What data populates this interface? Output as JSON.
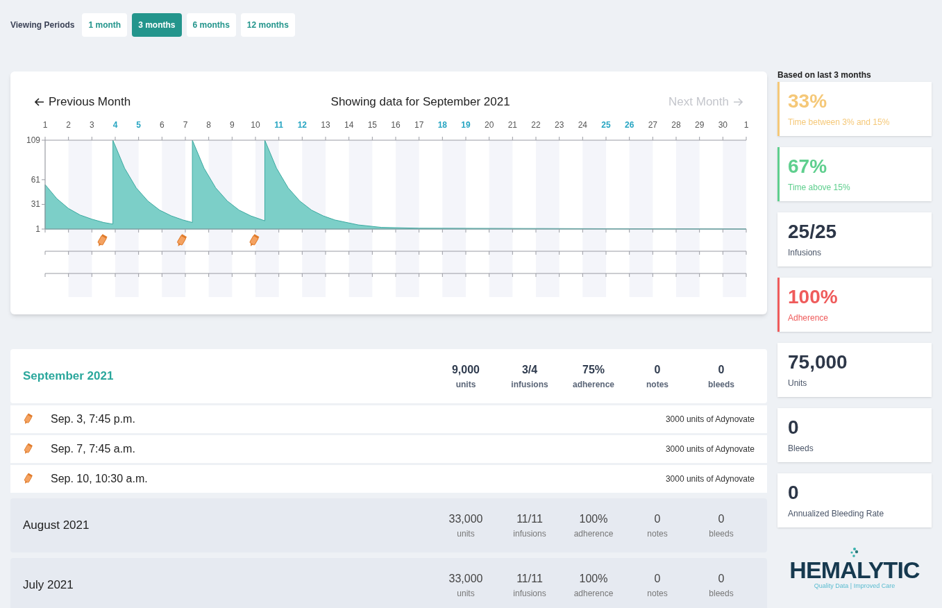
{
  "viewing_periods": {
    "label": "Viewing Periods",
    "options": [
      {
        "label": "1 month",
        "selected": false
      },
      {
        "label": "3 months",
        "selected": true
      },
      {
        "label": "6 months",
        "selected": false
      },
      {
        "label": "12 months",
        "selected": false
      }
    ]
  },
  "chart_card": {
    "previous": {
      "label": "Previous Month",
      "disabled": false
    },
    "title": "Showing data for September 2021",
    "next": {
      "label": "Next Month",
      "disabled": true
    },
    "day_labels": [
      {
        "label": "1",
        "weekend": false
      },
      {
        "label": "2",
        "weekend": false
      },
      {
        "label": "3",
        "weekend": false
      },
      {
        "label": "4",
        "weekend": true
      },
      {
        "label": "5",
        "weekend": true
      },
      {
        "label": "6",
        "weekend": false
      },
      {
        "label": "7",
        "weekend": false
      },
      {
        "label": "8",
        "weekend": false
      },
      {
        "label": "9",
        "weekend": false
      },
      {
        "label": "10",
        "weekend": false
      },
      {
        "label": "11",
        "weekend": true
      },
      {
        "label": "12",
        "weekend": true
      },
      {
        "label": "13",
        "weekend": false
      },
      {
        "label": "14",
        "weekend": false
      },
      {
        "label": "15",
        "weekend": false
      },
      {
        "label": "16",
        "weekend": false
      },
      {
        "label": "17",
        "weekend": false
      },
      {
        "label": "18",
        "weekend": true
      },
      {
        "label": "19",
        "weekend": true
      },
      {
        "label": "20",
        "weekend": false
      },
      {
        "label": "21",
        "weekend": false
      },
      {
        "label": "22",
        "weekend": false
      },
      {
        "label": "23",
        "weekend": false
      },
      {
        "label": "24",
        "weekend": false
      },
      {
        "label": "25",
        "weekend": true
      },
      {
        "label": "26",
        "weekend": true
      },
      {
        "label": "27",
        "weekend": false
      },
      {
        "label": "28",
        "weekend": false
      },
      {
        "label": "29",
        "weekend": false
      },
      {
        "label": "30",
        "weekend": false
      },
      {
        "label": "1",
        "weekend": false
      }
    ],
    "chart_data": {
      "type": "area",
      "xlim": [
        1,
        31
      ],
      "ylim": [
        1,
        109
      ],
      "yticks": [
        1,
        31,
        61,
        109
      ],
      "xticks": [
        1,
        2,
        3,
        4,
        5,
        6,
        7,
        8,
        9,
        10,
        11,
        12,
        13,
        14,
        15,
        16,
        17,
        18,
        19,
        20,
        21,
        22,
        23,
        24,
        25,
        26,
        27,
        28,
        29,
        30
      ],
      "x": [
        1,
        1.5,
        2,
        2.5,
        3,
        3.5,
        3.9,
        3.9,
        4.4,
        4.9,
        5.4,
        5.9,
        6.4,
        6.9,
        7.3,
        7.3,
        7.8,
        8.3,
        8.8,
        9.3,
        9.8,
        10.3,
        10.4,
        10.4,
        10.9,
        11.4,
        11.9,
        12.4,
        12.9,
        13.4,
        14.4,
        15.4,
        17,
        31
      ],
      "series": [
        {
          "color": "#7ccfc8",
          "values": [
            55,
            38,
            26,
            18,
            13,
            9,
            7,
            109,
            75,
            51,
            35,
            24,
            17,
            12,
            9,
            109,
            75,
            51,
            35,
            24,
            17,
            12,
            11,
            109,
            75,
            51,
            35,
            24,
            17,
            12,
            6,
            3,
            2,
            1
          ]
        }
      ]
    }
  },
  "months": [
    {
      "title": "September 2021",
      "expanded": true,
      "stats": [
        {
          "value": "9,000",
          "label": "units"
        },
        {
          "value": "3/4",
          "label": "infusions"
        },
        {
          "value": "75%",
          "label": "adherence"
        },
        {
          "value": "0",
          "label": "notes"
        },
        {
          "value": "0",
          "label": "bleeds"
        }
      ],
      "entries": [
        {
          "time": "Sep. 3, 7:45 p.m.",
          "detail": "3000 units of Adynovate"
        },
        {
          "time": "Sep. 7, 7:45 a.m.",
          "detail": "3000 units of Adynovate"
        },
        {
          "time": "Sep. 10, 10:30 a.m.",
          "detail": "3000 units of Adynovate"
        }
      ]
    },
    {
      "title": "August 2021",
      "expanded": false,
      "stats": [
        {
          "value": "33,000",
          "label": "units"
        },
        {
          "value": "11/11",
          "label": "infusions"
        },
        {
          "value": "100%",
          "label": "adherence"
        },
        {
          "value": "0",
          "label": "notes"
        },
        {
          "value": "0",
          "label": "bleeds"
        }
      ]
    },
    {
      "title": "July 2021",
      "expanded": false,
      "stats": [
        {
          "value": "33,000",
          "label": "units"
        },
        {
          "value": "11/11",
          "label": "infusions"
        },
        {
          "value": "100%",
          "label": "adherence"
        },
        {
          "value": "0",
          "label": "notes"
        },
        {
          "value": "0",
          "label": "bleeds"
        }
      ]
    }
  ],
  "summary": {
    "title": "Based on last 3 months",
    "cards": [
      {
        "value": "33%",
        "label": "Time between 3% and 15%",
        "color": "#f5c878"
      },
      {
        "value": "67%",
        "label": "Time above 15%",
        "color": "#5fcf8e"
      },
      {
        "value": "25/25",
        "label": "Infusions"
      },
      {
        "value": "100%",
        "label": "Adherence",
        "color": "#ef5b5b"
      },
      {
        "value": "75,000",
        "label": "Units"
      },
      {
        "value": "0",
        "label": "Bleeds"
      },
      {
        "value": "0",
        "label": "Annualized Bleeding Rate"
      }
    ]
  },
  "logo": {
    "name": "HEMALYTIC",
    "tagline": "Quality Data | Improved Care"
  }
}
